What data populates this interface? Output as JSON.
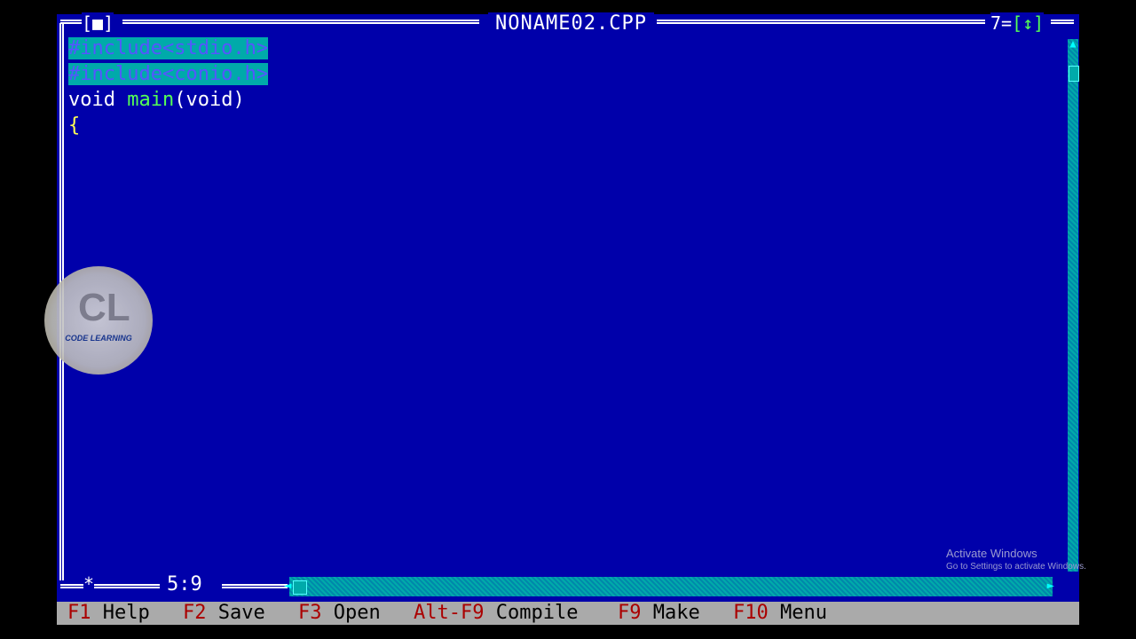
{
  "window": {
    "title": "NONAME02.CPP",
    "close_box": "[■]",
    "window_number": "7",
    "zoom_box": "[↕]"
  },
  "editor": {
    "lines": [
      {
        "tokens": [
          {
            "text": "#include<stdio.h>",
            "style": "sel"
          }
        ]
      },
      {
        "tokens": [
          {
            "text": "#include<conio.h>",
            "style": "sel"
          }
        ]
      },
      {
        "tokens": [
          {
            "text": "void ",
            "style": "kw"
          },
          {
            "text": "main",
            "style": "fn"
          },
          {
            "text": "(void)",
            "style": "kw"
          }
        ]
      },
      {
        "tokens": [
          {
            "text": "{",
            "style": "paren"
          }
        ]
      }
    ],
    "cursor_position": "5:9",
    "modified_marker": "*"
  },
  "status_bar": {
    "items": [
      {
        "key": "F1",
        "label": "Help"
      },
      {
        "key": "F2",
        "label": "Save"
      },
      {
        "key": "F3",
        "label": "Open"
      },
      {
        "key": "Alt-F9",
        "label": "Compile"
      },
      {
        "key": "F9",
        "label": "Make"
      },
      {
        "key": "F10",
        "label": "Menu"
      }
    ]
  },
  "overlay": {
    "logo_mark": "CL",
    "logo_name": "CODE LEARNING",
    "activate_title": "Activate Windows",
    "activate_sub": "Go to Settings to activate Windows."
  },
  "colors": {
    "editor_bg": "#0000aa",
    "selection_bg": "#00aaaa",
    "status_bg": "#aaaaaa",
    "hotkey": "#aa0000"
  }
}
